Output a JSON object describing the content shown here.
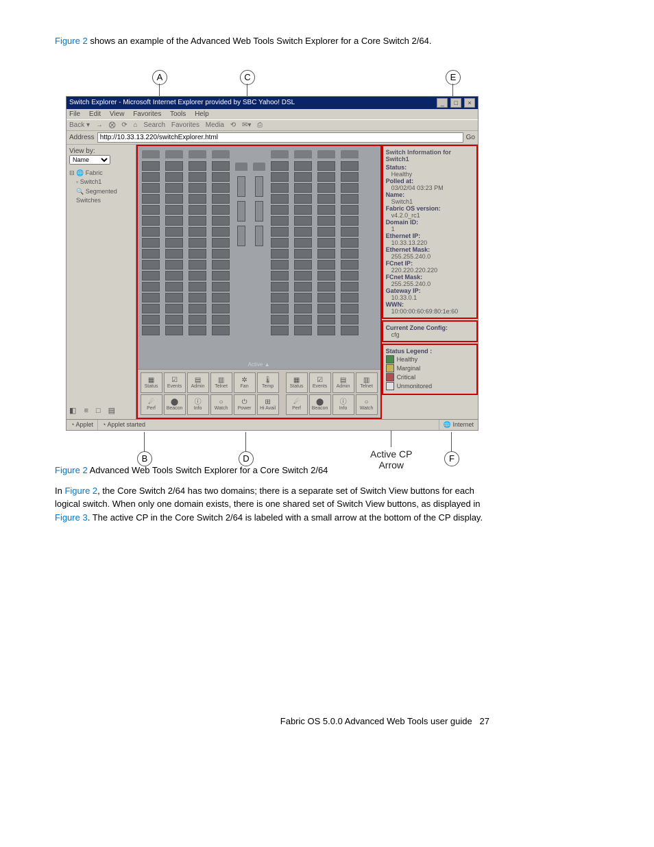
{
  "intro": {
    "fig_link": "Figure 2",
    "text_after": " shows an example of the Advanced Web Tools Switch Explorer for a Core Switch 2/64."
  },
  "callouts": {
    "A": "A",
    "B": "B",
    "C": "C",
    "D": "D",
    "E": "E",
    "F": "F",
    "active_cp": "Active CP\nArrow"
  },
  "window": {
    "title": "Switch Explorer - Microsoft Internet Explorer provided by SBC Yahoo! DSL",
    "btn_min": "_",
    "btn_max": "□",
    "btn_close": "×",
    "menu": {
      "file": "File",
      "edit": "Edit",
      "view": "View",
      "favorites": "Favorites",
      "tools": "Tools",
      "help": "Help"
    },
    "toolbar": {
      "back": "Back ▾",
      "fwd": "→",
      "stop": "⨂",
      "refresh": "⟳",
      "home": "⌂",
      "search": "Search",
      "favorites": "Favorites",
      "media": "Media",
      "history": "⟲",
      "mail": "✉▾",
      "print": "⎙"
    },
    "address_label": "Address",
    "address_value": "http://10.33.13.220/switchExplorer.html",
    "go": "Go"
  },
  "left": {
    "viewby_label": "View by:",
    "viewby_value": "Name",
    "tree_root": "Fabric",
    "tree_switch": "Switch1",
    "tree_segmented": "Segmented Switches",
    "bottom_icons": "◧ ≡ □ ▤"
  },
  "center": {
    "active_arrow": "Active ▲",
    "buttons_row1": [
      "Status",
      "Events",
      "Admin",
      "Telnet",
      "Fan",
      "Temp",
      "Status",
      "Events",
      "Admin",
      "Telnet"
    ],
    "buttons_row2": [
      "Perf",
      "Beacon",
      "Info",
      "Watch",
      "Power",
      "Hi Avail",
      "Perf",
      "Beacon",
      "Info",
      "Watch"
    ],
    "icons_row1": [
      "▦",
      "☑",
      "▤",
      "▥",
      "✲",
      "🌡",
      "▦",
      "☑",
      "▤",
      "▥"
    ],
    "icons_row2": [
      "☄",
      "⬤",
      "ⓘ",
      "○",
      "⏻",
      "⊞",
      "☄",
      "⬤",
      "ⓘ",
      "○"
    ]
  },
  "right": {
    "info_title": "Switch Information for Switch1",
    "status_l": "Status:",
    "status_v": "Healthy",
    "polled_l": "Polled at:",
    "polled_v": "03/02/04 03:23 PM",
    "name_l": "Name:",
    "name_v": "Switch1",
    "os_l": "Fabric OS version:",
    "os_v": "v4.2.0_rc1",
    "domain_l": "Domain ID:",
    "domain_v": "1",
    "eip_l": "Ethernet IP:",
    "eip_v": "10.33.13.220",
    "emask_l": "Ethernet Mask:",
    "emask_v": "255.255.240.0",
    "fcip_l": "FCnet IP:",
    "fcip_v": "220.220.220.220",
    "fcmask_l": "FCnet Mask:",
    "fcmask_v": "255.255.240.0",
    "gw_l": "Gateway IP:",
    "gw_v": "10.33.0.1",
    "wwn_l": "WWN:",
    "wwn_v": "10:00:00:60:69:80:1e:60",
    "zone_title": "Current Zone Config:",
    "zone_value": "cfg",
    "legend_title": "Status Legend :",
    "legend": [
      {
        "label": "Healthy",
        "color": "#4a8a4a"
      },
      {
        "label": "Marginal",
        "color": "#c8b060"
      },
      {
        "label": "Critical",
        "color": "#b05050"
      },
      {
        "label": "Unmonitored",
        "color": "#e0e0e0"
      }
    ]
  },
  "statusbar": {
    "applet1": "Applet",
    "applet_started": "Applet started",
    "internet": "Internet"
  },
  "caption": {
    "label": "Figure 2",
    "text": "  Advanced Web Tools Switch Explorer for a Core Switch 2/64"
  },
  "body": {
    "p1_a": "In ",
    "p1_link1": "Figure 2",
    "p1_b": ", the Core Switch 2/64 has two domains; there is a separate set of Switch View buttons for each logical switch. When only one domain exists, there is one shared set of Switch View buttons, as displayed in ",
    "p1_link2": "Figure 3",
    "p1_c": ". The active CP in the Core Switch 2/64 is labeled with a small arrow at the bottom of the CP display."
  },
  "footer": {
    "text": "Fabric OS 5.0.0 Advanced Web Tools user guide",
    "page": "27"
  }
}
